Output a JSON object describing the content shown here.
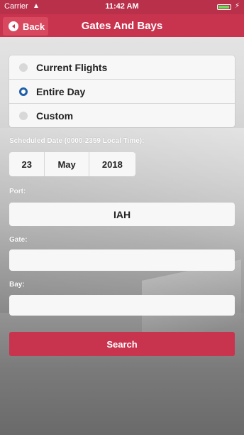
{
  "status_bar": {
    "carrier": "Carrier",
    "wifi_icon": "wifi-icon",
    "time": "11:42 AM",
    "battery_icon": "battery-icon",
    "charging_icon": "charging-bolt-icon",
    "colors": {
      "bar": "#b8304a",
      "battery_fill": "#6ddc5a"
    }
  },
  "nav": {
    "back_label": "Back",
    "back_icon": "chevron-left-circle-icon",
    "title": "Gates And Bays",
    "colors": {
      "bar": "#c8334e",
      "back_button": "#d8495f"
    }
  },
  "options": {
    "items": [
      {
        "label": "Current Flights",
        "selected": false
      },
      {
        "label": "Entire Day",
        "selected": true
      },
      {
        "label": "Custom",
        "selected": false
      }
    ],
    "colors": {
      "selected": "#1f5fa8",
      "unselected": "#d8d8d8"
    }
  },
  "scheduled_date": {
    "label": "Scheduled Date (0000-2359 Local Time):",
    "day": "23",
    "month": "May",
    "year": "2018"
  },
  "port": {
    "label": "Port:",
    "value": "IAH"
  },
  "gate": {
    "label": "Gate:",
    "value": ""
  },
  "bay": {
    "label": "Bay:",
    "value": ""
  },
  "search": {
    "label": "Search",
    "color": "#c8334e"
  }
}
